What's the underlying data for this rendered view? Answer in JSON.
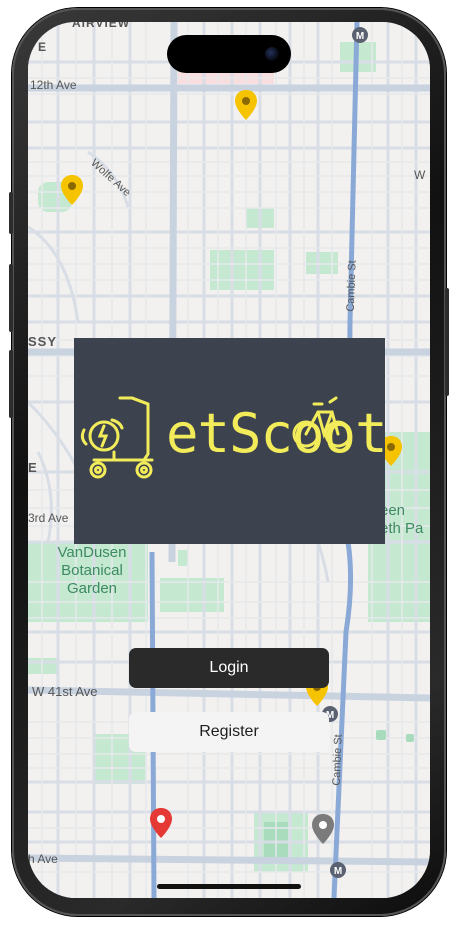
{
  "app": {
    "logo_text": "etScoot",
    "login_label": "Login",
    "register_label": "Register"
  },
  "map": {
    "labels": {
      "fairview": "AIRVIEW",
      "e_top": "E",
      "twelfth": "12th Ave",
      "wolfe": "Wolfe Ave",
      "w_right": "W",
      "shaughnessy": "SSY",
      "e_mid": "E",
      "third": "3rd Ave",
      "cambie_top": "Cambie St",
      "cambie_bottom": "Cambie St",
      "w41": "W 41st Ave",
      "ave_bottom": "h Ave",
      "queen_elizabeth": "een\neth Pa",
      "vandusen": "VanDusen\nBotanical\nGarden"
    },
    "icons": [
      "metro-icon",
      "map-pin-yellow",
      "map-pin-red",
      "map-pin-gray"
    ]
  },
  "colors": {
    "logo_bg": "#3c424e",
    "logo_accent": "#f2ec5a",
    "login_bg": "#2a2a2a",
    "register_bg": "#f4f4f4",
    "pin_yellow": "#f5c300",
    "pin_red": "#e53935",
    "pin_gray": "#7b7b7b",
    "park_green": "#c4e9d0"
  }
}
